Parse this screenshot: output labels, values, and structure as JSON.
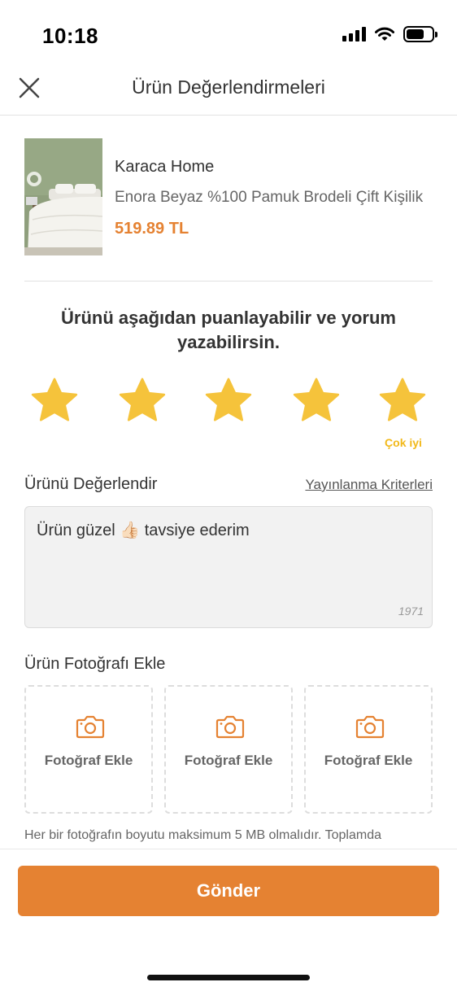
{
  "status_bar": {
    "time": "10:18"
  },
  "nav": {
    "title": "Ürün Değerlendirmeleri",
    "close_icon": "close-icon"
  },
  "product": {
    "brand": "Karaca Home",
    "name": "Enora Beyaz %100 Pamuk Brodeli Çift Kişilik",
    "price": "519.89 TL"
  },
  "rating": {
    "prompt": "Ürünü aşağıdan puanlayabilir ve yorum yazabilirsin.",
    "value": 5,
    "max": 5,
    "label": "Çok iyi",
    "star_color": "#f5c33b"
  },
  "review": {
    "section_title": "Ürünü Değerlendir",
    "criteria_link": "Yayınlanma Kriterleri",
    "text": "Ürün güzel 👍🏻 tavsiye ederim",
    "remaining_chars": "1971"
  },
  "photos": {
    "section_title": "Ürün Fotoğrafı Ekle",
    "slots": [
      {
        "label": "Fotoğraf Ekle",
        "icon": "camera-icon"
      },
      {
        "label": "Fotoğraf Ekle",
        "icon": "camera-icon"
      },
      {
        "label": "Fotoğraf Ekle",
        "icon": "camera-icon"
      }
    ],
    "note": "Her bir fotoğrafın boyutu maksimum 5 MB olmalıdır. Toplamda"
  },
  "actions": {
    "send_label": "Gönder"
  },
  "colors": {
    "accent": "#e58232",
    "star": "#f5c33b"
  }
}
